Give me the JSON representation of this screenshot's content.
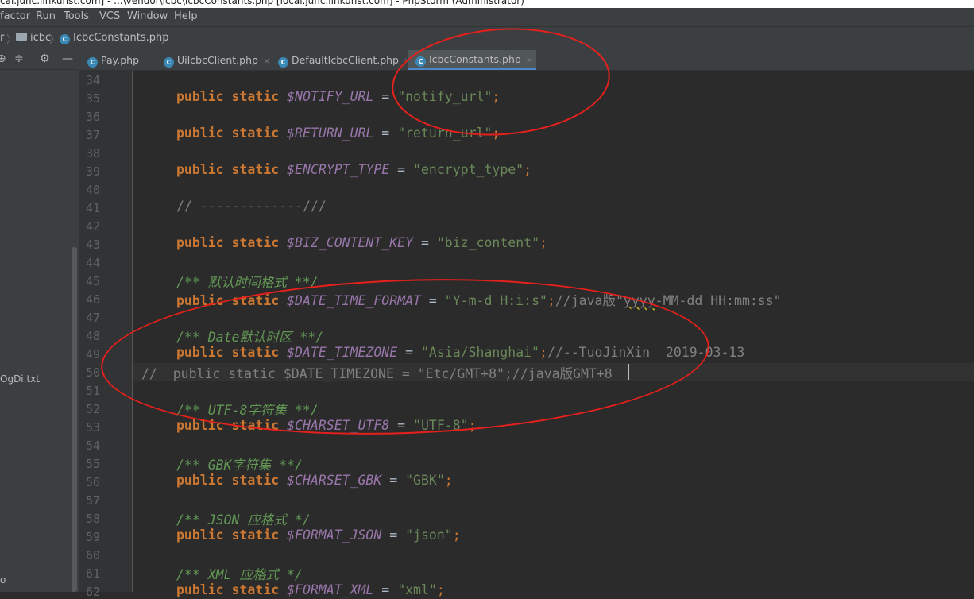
{
  "window": {
    "title": "cal.junc.linkunst.com] - ...\\vendor\\icbc\\IcbcConstants.php [local.junc.linkunst.com] - PhpStorm (Administrator)"
  },
  "menu": {
    "refactor": "factor",
    "run": "Run",
    "tools": "Tools",
    "vcs": "VCS",
    "window": "Window",
    "help": "Help"
  },
  "breadcrumb": {
    "prev": "r",
    "folder": "icbc",
    "file": "IcbcConstants.php",
    "folder_icon": "folder-icon",
    "file_icon": "php-file-icon"
  },
  "sidebar": {
    "file_item": "OgDi.txt",
    "bottom": "o"
  },
  "tabs": [
    {
      "label": "Pay.php",
      "active": false
    },
    {
      "label": "UiIcbcClient.php",
      "active": false
    },
    {
      "label": "DefaultIcbcClient.php",
      "active": false
    },
    {
      "label": "IcbcConstants.php",
      "active": true
    }
  ],
  "tab_close": "×",
  "line_numbers": [
    "34",
    "35",
    "36",
    "37",
    "38",
    "39",
    "40",
    "41",
    "42",
    "43",
    "44",
    "45",
    "46",
    "47",
    "48",
    "49",
    "50",
    "51",
    "52",
    "53",
    "54",
    "55",
    "56",
    "57",
    "58",
    "59",
    "60",
    "61",
    "62"
  ],
  "code": {
    "kw_public": "public",
    "kw_static": "static",
    "assign": " = ",
    "semi": ";",
    "l35": {
      "var": "$NOTIFY_URL",
      "str": "\"notify_url\""
    },
    "l37": {
      "var": "$RETURN_URL",
      "str": "\"return_url\""
    },
    "l39": {
      "var": "$ENCRYPT_TYPE",
      "str": "\"encrypt_type\""
    },
    "l41": {
      "cmt": "// -------------///"
    },
    "l43": {
      "var": "$BIZ_CONTENT_KEY",
      "str": "\"biz_content\""
    },
    "l45": {
      "doc": "/** 默认时间格式 **/"
    },
    "l46": {
      "var": "$DATE_TIME_FORMAT",
      "str": "\"Y-m-d H:i:s\"",
      "cmt_a": "//java版\"",
      "cmt_b": "yyyy",
      "cmt_c": "-MM-dd HH:mm:ss\""
    },
    "l48": {
      "doc": "/** Date默认时区 **/"
    },
    "l49": {
      "var": "$DATE_TIMEZONE",
      "str": "\"Asia/Shanghai\"",
      "cmt": "//--TuoJinXin  2019-03-13"
    },
    "l50": {
      "prefix": "//  ",
      "text": "public static $DATE_TIMEZONE = \"Etc/GMT+8\";//java版GMT+8"
    },
    "l52": {
      "doc": "/** UTF-8字符集 **/"
    },
    "l53": {
      "var": "$CHARSET_UTF8",
      "str": "\"UTF-8\""
    },
    "l55": {
      "doc": "/** GBK字符集 **/"
    },
    "l56": {
      "var": "$CHARSET_GBK",
      "str": "\"GBK\""
    },
    "l58": {
      "doc": "/** JSON 应格式 */"
    },
    "l59": {
      "var": "$FORMAT_JSON",
      "str": "\"json\""
    },
    "l61": {
      "doc": "/** XML 应格式 */"
    },
    "l62": {
      "var": "$FORMAT_XML",
      "str": "\"xml\""
    }
  },
  "colors": {
    "annotation": "#e8201c",
    "keyword": "#cc7832",
    "variable": "#9876aa",
    "string": "#6a8759",
    "comment": "#808080",
    "doc_comment": "#629755"
  }
}
